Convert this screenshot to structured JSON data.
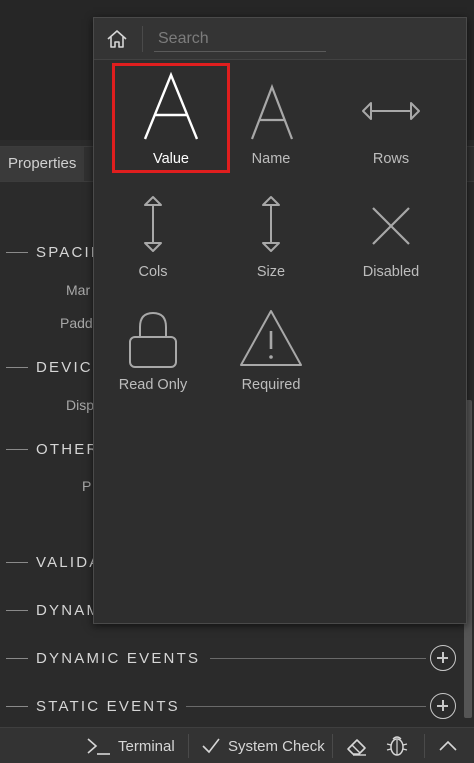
{
  "background": {
    "tab_label": "Properties",
    "sections": [
      {
        "title": "SPACIN"
      },
      {
        "title": "DEVIC"
      },
      {
        "title": "OTHER"
      },
      {
        "title": "VALIDA"
      },
      {
        "title": "DYNAM"
      },
      {
        "title": "DYNAMIC EVENTS"
      },
      {
        "title": "STATIC EVENTS"
      }
    ],
    "subrows": [
      "Mar",
      "Padd",
      "Disp",
      "P"
    ]
  },
  "popup": {
    "search_placeholder": "Search",
    "tiles": [
      {
        "label": "Value",
        "icon": "letter-a-icon",
        "selected": true
      },
      {
        "label": "Name",
        "icon": "letter-a-icon"
      },
      {
        "label": "Rows",
        "icon": "horizontal-arrows-icon"
      },
      {
        "label": "Cols",
        "icon": "vertical-arrows-icon"
      },
      {
        "label": "Size",
        "icon": "vertical-arrows-icon"
      },
      {
        "label": "Disabled",
        "icon": "x-icon"
      },
      {
        "label": "Read Only",
        "icon": "lock-icon"
      },
      {
        "label": "Required",
        "icon": "warning-icon"
      }
    ]
  },
  "toolbar": {
    "terminal_label": "Terminal",
    "system_check_label": "System Check"
  },
  "colors": {
    "selection_outline": "#e01e1e",
    "popup_bg": "#2e2e2e",
    "panel_bg": "#2b2b2b"
  }
}
